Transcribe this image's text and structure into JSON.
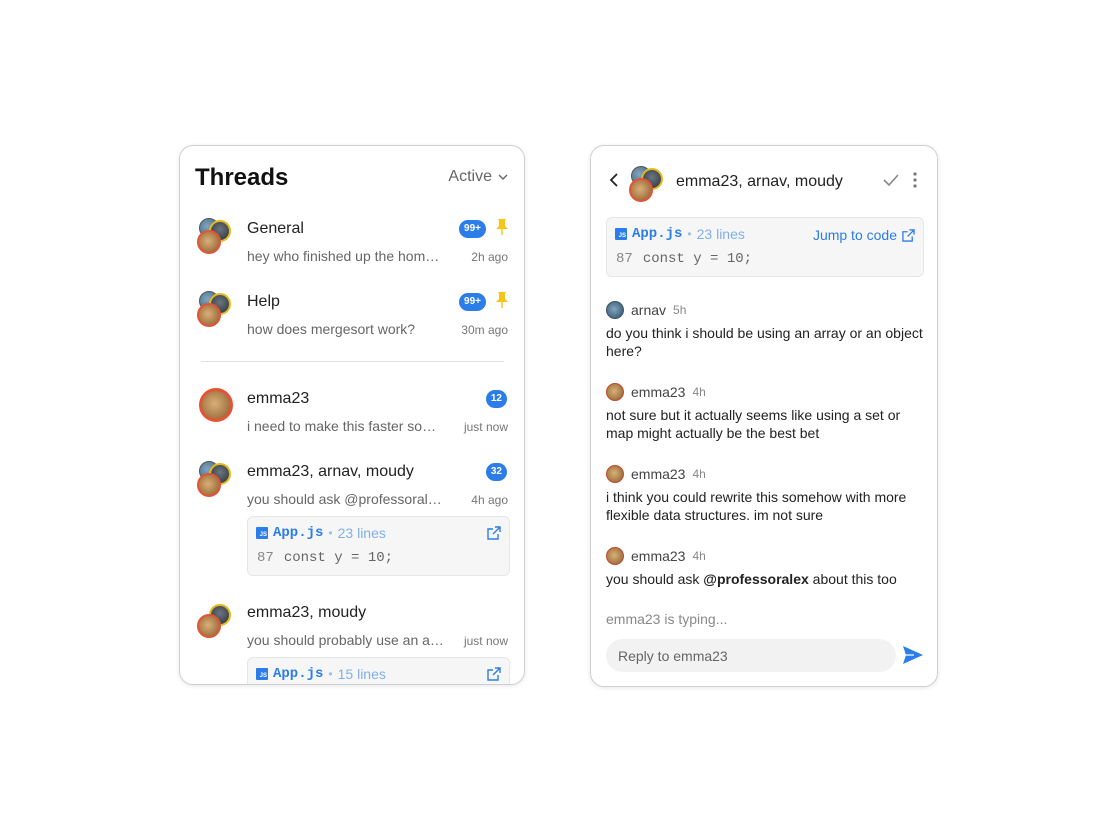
{
  "threads_panel": {
    "title": "Threads",
    "filter_label": "Active",
    "pinned": [
      {
        "name": "General",
        "preview": "hey who finished up the homework",
        "badge": "99+",
        "time": "2h ago"
      },
      {
        "name": "Help",
        "preview": "how does mergesort work?",
        "badge": "99+",
        "time": "30m ago"
      }
    ],
    "threads": [
      {
        "name": "emma23",
        "preview": "i need to make this faster somehow",
        "badge": "12",
        "time": "just now"
      },
      {
        "name": "emma23, arnav, moudy",
        "preview": "you should ask @professoralex about this too",
        "badge": "32",
        "time": "4h ago",
        "code": {
          "file": "App.js",
          "lines": "23 lines",
          "line_no": "87",
          "code_text": "const y = 10;"
        }
      },
      {
        "name": "emma23, moudy",
        "preview": "you should probably use an array",
        "time": "just now",
        "code": {
          "file": "App.js",
          "lines": "15 lines"
        }
      }
    ]
  },
  "conversation": {
    "title": "emma23, arnav, moudy",
    "code": {
      "file": "App.js",
      "lines": "23 lines",
      "jump_label": "Jump to code",
      "line_no": "87",
      "code_text": "const y = 10;"
    },
    "messages": [
      {
        "author": "arnav",
        "time": "5h",
        "text": "do you think i should be using an array or an object here?"
      },
      {
        "author": "emma23",
        "time": "4h",
        "text": "not sure but it actually seems like using a set or map might actually be the best bet"
      },
      {
        "author": "emma23",
        "time": "4h",
        "text": "i think you could rewrite this somehow with more flexible data structures. im not sure"
      },
      {
        "author": "emma23",
        "time": "4h",
        "text_before": "you should ask ",
        "mention": "@professoralex",
        "text_after": " about this too"
      }
    ],
    "typing": "emma23 is typing...",
    "reply_placeholder": "Reply to emma23"
  },
  "colors": {
    "accent": "#2b7de9",
    "pin": "#f5c518",
    "avatar_ring": "#e45334"
  },
  "icons": [
    "chevron-down-icon",
    "pin-icon",
    "external-link-icon",
    "js-file-icon",
    "back-arrow-icon",
    "check-icon",
    "kebab-menu-icon",
    "send-icon"
  ]
}
